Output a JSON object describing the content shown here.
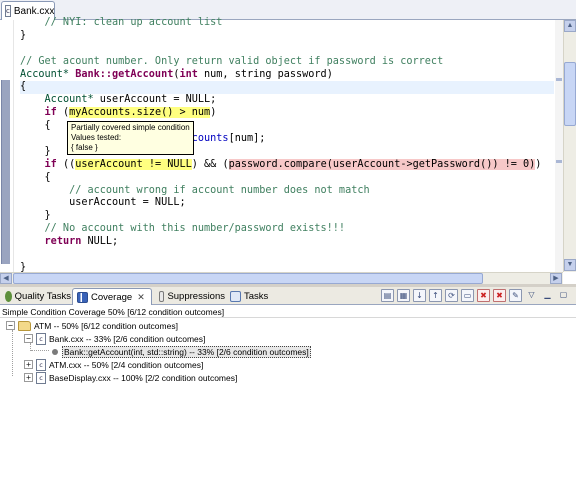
{
  "editor": {
    "tab_label": "Bank.cxx",
    "lines": [
      {
        "segments": [
          {
            "t": "    // NYI: clean up account list",
            "c": "cm"
          }
        ]
      },
      {
        "segments": [
          {
            "t": "}",
            "c": ""
          }
        ]
      },
      {
        "segments": [
          {
            "t": "",
            "c": ""
          }
        ]
      },
      {
        "segments": [
          {
            "t": "// Get acount number. Only return valid object if password is correct",
            "c": "cm"
          }
        ]
      },
      {
        "segments": [
          {
            "t": "Account* ",
            "c": "ty"
          },
          {
            "t": "Bank::getAccount",
            "c": "kw"
          },
          {
            "t": "(",
            "c": ""
          },
          {
            "t": "int",
            "c": "kw"
          },
          {
            "t": " num, string password)",
            "c": ""
          }
        ]
      },
      {
        "segments": [
          {
            "t": "{",
            "c": ""
          }
        ],
        "current": true
      },
      {
        "segments": [
          {
            "t": "    ",
            "c": ""
          },
          {
            "t": "Account* ",
            "c": "ty"
          },
          {
            "t": "userAccount = NULL;",
            "c": ""
          }
        ]
      },
      {
        "segments": [
          {
            "t": "    ",
            "c": ""
          },
          {
            "t": "if",
            "c": "kw"
          },
          {
            "t": " (",
            "c": ""
          },
          {
            "t": "myAccounts.size() > num",
            "c": "hl-y"
          },
          {
            "t": ")",
            "c": ""
          }
        ]
      },
      {
        "segments": [
          {
            "t": "    {",
            "c": ""
          }
        ]
      },
      {
        "segments": [
          {
            "t": "                     ",
            "c": ""
          },
          {
            "t": "t*)",
            "c": ""
          },
          {
            "t": "myAccounts",
            "c": "fld"
          },
          {
            "t": "[num];",
            "c": ""
          }
        ]
      },
      {
        "segments": [
          {
            "t": "    }",
            "c": ""
          }
        ]
      },
      {
        "segments": [
          {
            "t": "    ",
            "c": ""
          },
          {
            "t": "if",
            "c": "kw"
          },
          {
            "t": " ((",
            "c": ""
          },
          {
            "t": "userAccount != NULL",
            "c": "hl-y"
          },
          {
            "t": ") && (",
            "c": ""
          },
          {
            "t": "password.compare(userAccount->getPassword()) != 0)",
            "c": "hl-r"
          },
          {
            "t": ")",
            "c": ""
          }
        ]
      },
      {
        "segments": [
          {
            "t": "    {",
            "c": ""
          }
        ]
      },
      {
        "segments": [
          {
            "t": "        // account wrong if account number does not match",
            "c": "cm"
          }
        ]
      },
      {
        "segments": [
          {
            "t": "        userAccount = NULL;",
            "c": ""
          }
        ]
      },
      {
        "segments": [
          {
            "t": "    }",
            "c": ""
          }
        ]
      },
      {
        "segments": [
          {
            "t": "    // No account with this number/password exists!!!",
            "c": "cm"
          }
        ]
      },
      {
        "segments": [
          {
            "t": "    ",
            "c": ""
          },
          {
            "t": "return",
            "c": "kw"
          },
          {
            "t": " NULL;",
            "c": ""
          }
        ]
      },
      {
        "segments": [
          {
            "t": "",
            "c": ""
          }
        ]
      },
      {
        "segments": [
          {
            "t": "}",
            "c": ""
          }
        ]
      }
    ]
  },
  "tooltip": {
    "line1": "Partially covered simple condition",
    "line2": "Values tested:",
    "line3": "{ false }"
  },
  "views": {
    "tabs": [
      {
        "label": "Quality Tasks",
        "icon": "quality-tasks-icon",
        "active": false
      },
      {
        "label": "Coverage",
        "icon": "coverage-icon",
        "active": true
      },
      {
        "label": "Suppressions",
        "icon": "suppressions-icon",
        "active": false
      },
      {
        "label": "Tasks",
        "icon": "tasks-icon",
        "active": false
      }
    ],
    "close_glyph": "✕"
  },
  "coverage": {
    "header": "Simple Condition Coverage 50% [6/12 condition outcomes]",
    "tree": {
      "root": "ATM -- 50% [6/12 condition outcomes]",
      "bank": "Bank.cxx -- 33% [2/6 condition outcomes]",
      "bank_fn": "Bank::getAccount(int, std::string) -- 33% [2/6 condition outcomes]",
      "atm": "ATM.cxx -- 50% [2/4 condition outcomes]",
      "display": "BaseDisplay.cxx -- 100% [2/2 condition outcomes]"
    },
    "expand_minus": "−",
    "expand_plus": "+"
  },
  "colors": {
    "condition_partial": "#ffff80",
    "condition_uncovered": "#f7c8c8",
    "coverage_bar": "#9aa4c0"
  }
}
